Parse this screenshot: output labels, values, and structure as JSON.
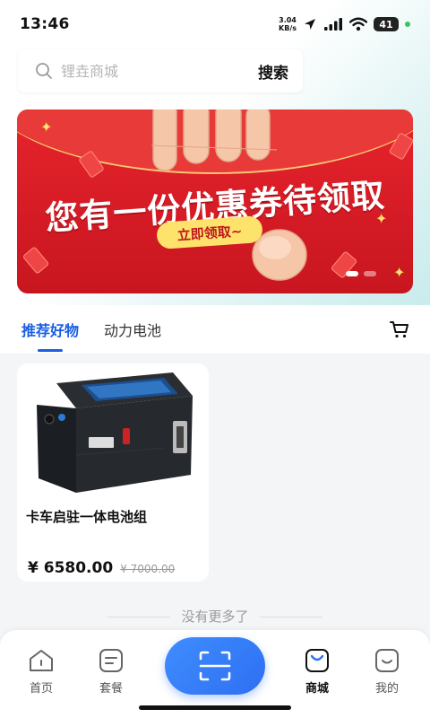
{
  "status_bar": {
    "time": "13:46",
    "net_speed_value": "3.04",
    "net_speed_unit": "KB/s",
    "battery": "41"
  },
  "search": {
    "placeholder": "锂垚商城",
    "button_label": "搜索"
  },
  "banner": {
    "headline": "您有一份优惠券待领取",
    "cta_label": "立即领取~",
    "slide_count": 2,
    "active_slide": 1
  },
  "tabs": [
    {
      "label": "推荐好物",
      "active": true
    },
    {
      "label": "动力电池",
      "active": false
    }
  ],
  "products": [
    {
      "title": "卡车启驻一体电池组",
      "price": "¥ 6580.00",
      "original_price": "¥ 7000.00"
    }
  ],
  "list_end_text": "没有更多了",
  "bottom_nav": {
    "items": [
      {
        "label": "首页",
        "icon": "home-icon",
        "active": false
      },
      {
        "label": "套餐",
        "icon": "package-icon",
        "active": false
      },
      {
        "label": "商城",
        "icon": "shop-bag-icon",
        "active": true
      },
      {
        "label": "我的",
        "icon": "profile-icon",
        "active": false
      }
    ],
    "center_button_icon": "scan-icon"
  },
  "colors": {
    "accent": "#1a5ee6",
    "banner_red": "#d41b25",
    "cta_yellow": "#fde36b",
    "scan_blue": "#3f8dfd"
  }
}
